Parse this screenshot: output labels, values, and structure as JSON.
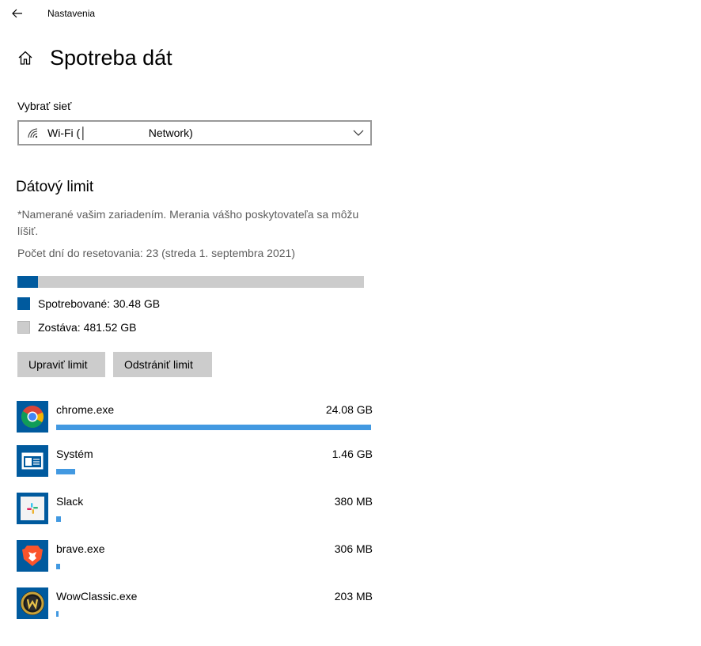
{
  "window": {
    "title": "Nastavenia"
  },
  "page": {
    "title": "Spotreba dát"
  },
  "network": {
    "label": "Vybrať sieť",
    "selected": "Wi-Fi (│                    Network)"
  },
  "limit": {
    "title": "Dátový limit",
    "note": "*Namerané vašim zariadením. Merania vášho poskytovateľa sa môžu líšiť.",
    "reset_info": "Počet dní do resetovania: 23 (streda 1. septembra 2021)",
    "used_fraction": 0.06,
    "used_label": "Spotrebované: 30.48 GB",
    "remaining_label": "Zostáva: 481.52 GB",
    "edit_button": "Upraviť limit",
    "remove_button": "Odstrániť limit"
  },
  "apps": [
    {
      "name": "chrome.exe",
      "size": "24.08 GB",
      "usage_fraction": 1.0,
      "icon": "chrome-icon"
    },
    {
      "name": "Systém",
      "size": "1.46 GB",
      "usage_fraction": 0.061,
      "icon": "system-icon"
    },
    {
      "name": "Slack",
      "size": "380 MB",
      "usage_fraction": 0.016,
      "icon": "slack-icon"
    },
    {
      "name": "brave.exe",
      "size": "306 MB",
      "usage_fraction": 0.013,
      "icon": "brave-icon"
    },
    {
      "name": "WowClassic.exe",
      "size": "203 MB",
      "usage_fraction": 0.008,
      "icon": "wow-icon"
    }
  ],
  "colors": {
    "accent": "#005a9e",
    "app_bar": "#4299e1",
    "remaining": "#cccccc"
  }
}
